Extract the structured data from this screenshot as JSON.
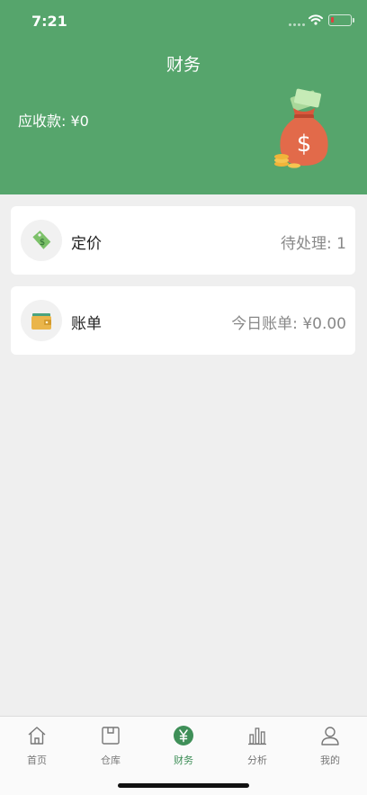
{
  "status": {
    "time": "7:21"
  },
  "header": {
    "title": "财务",
    "receivable": "应收款: ¥0"
  },
  "cards": [
    {
      "label": "定价",
      "value": "待处理: 1",
      "icon": "price-tag-icon"
    },
    {
      "label": "账单",
      "value": "今日账单: ¥0.00",
      "icon": "wallet-icon"
    }
  ],
  "tabbar": [
    {
      "label": "首页",
      "icon": "home-icon"
    },
    {
      "label": "仓库",
      "icon": "warehouse-icon"
    },
    {
      "label": "财务",
      "icon": "yuan-icon",
      "active": true
    },
    {
      "label": "分析",
      "icon": "bar-chart-icon"
    },
    {
      "label": "我的",
      "icon": "user-icon"
    }
  ],
  "colors": {
    "header": "#56a56c",
    "accent": "#3f8f58",
    "background": "#efefef"
  }
}
